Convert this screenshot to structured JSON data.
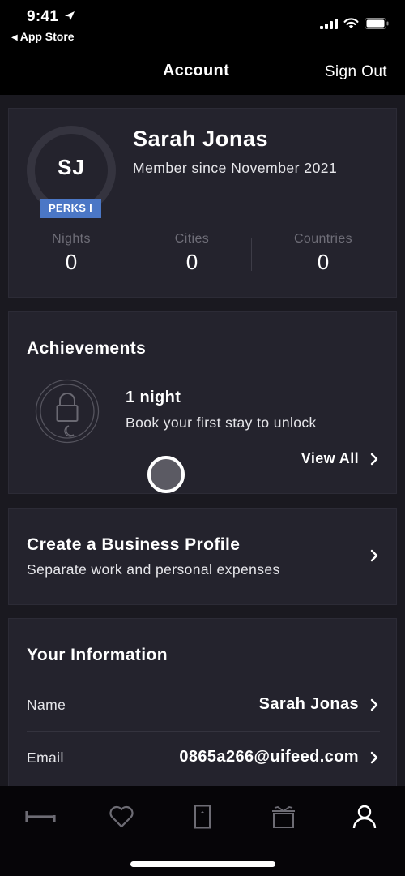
{
  "status_bar": {
    "time": "9:41",
    "back_label": "App Store",
    "icons": [
      "location-arrow-icon",
      "signal-icon",
      "wifi-icon",
      "battery-icon"
    ]
  },
  "nav": {
    "title": "Account",
    "sign_out": "Sign Out"
  },
  "profile": {
    "initials": "SJ",
    "tier": "PERKS I",
    "name": "Sarah Jonas",
    "member_since": "Member since November 2021",
    "stats": [
      {
        "label": "Nights",
        "value": "0"
      },
      {
        "label": "Cities",
        "value": "0"
      },
      {
        "label": "Countries",
        "value": "0"
      }
    ]
  },
  "achievements": {
    "title": "Achievements",
    "badge_icon": "locked-moon-badge-icon",
    "item_name": "1 night",
    "item_desc": "Book your first stay to unlock",
    "view_all": "View All"
  },
  "business": {
    "title": "Create a Business Profile",
    "subtitle": "Separate work and personal expenses"
  },
  "info": {
    "title": "Your Information",
    "rows": [
      {
        "label": "Name",
        "value": "Sarah Jonas"
      },
      {
        "label": "Email",
        "value": "0865a266@uifeed.com"
      }
    ]
  },
  "tab_bar": {
    "tabs": [
      {
        "icon": "bed-icon",
        "active": false
      },
      {
        "icon": "heart-icon",
        "active": false
      },
      {
        "icon": "door-icon",
        "active": false
      },
      {
        "icon": "gift-icon",
        "active": false
      },
      {
        "icon": "person-icon",
        "active": true
      }
    ]
  },
  "colors": {
    "accent_badge": "#4b77c6",
    "card_bg": "#24232d",
    "page_bg": "#1a1920",
    "inactive_icon": "#6d6c74",
    "active_icon": "#ffffff"
  }
}
